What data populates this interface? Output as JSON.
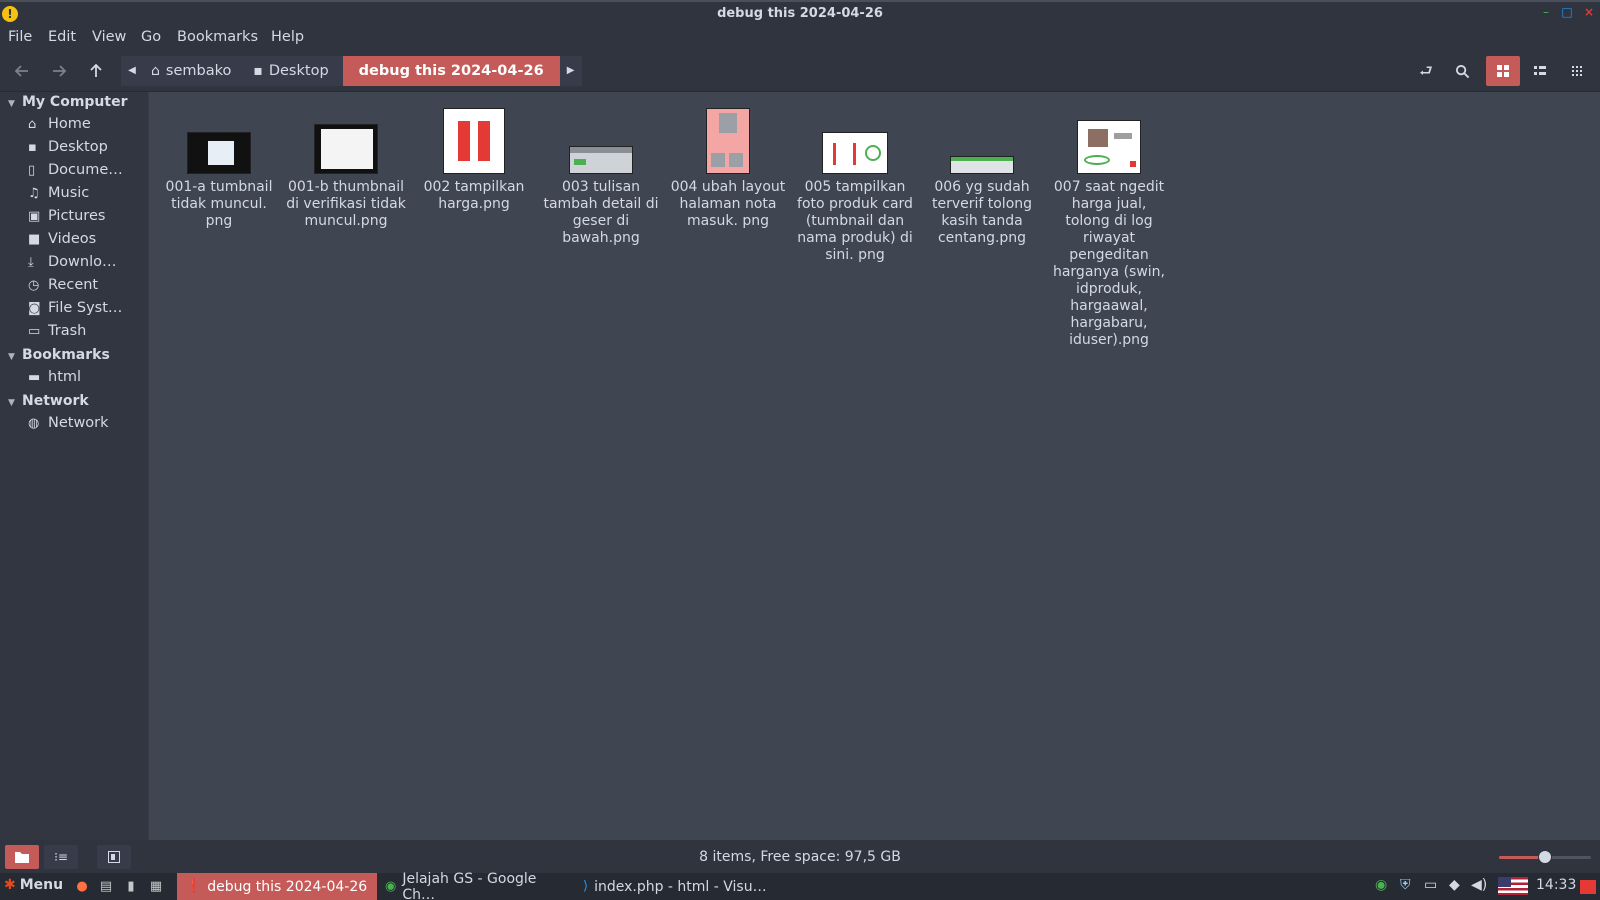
{
  "window": {
    "title": "debug this 2024-04-26",
    "warn_glyph": "!",
    "min_glyph": "–",
    "max_glyph": "□",
    "close_glyph": "×"
  },
  "menu": [
    "File",
    "Edit",
    "View",
    "Go",
    "Bookmarks",
    "Help"
  ],
  "toolbar": {
    "crumbs": [
      "sembako",
      "Desktop",
      "debug this 2024-04-26"
    ]
  },
  "sidebar": {
    "sections": [
      {
        "title": "My Computer",
        "items": [
          {
            "label": "Home",
            "icon": "home-icon"
          },
          {
            "label": "Desktop",
            "icon": "desktop-icon"
          },
          {
            "label": "Docume…",
            "icon": "document-icon"
          },
          {
            "label": "Music",
            "icon": "music-icon"
          },
          {
            "label": "Pictures",
            "icon": "pictures-icon"
          },
          {
            "label": "Videos",
            "icon": "videos-icon"
          },
          {
            "label": "Downlo…",
            "icon": "download-icon"
          },
          {
            "label": "Recent",
            "icon": "recent-icon"
          },
          {
            "label": "File Syst…",
            "icon": "filesystem-icon"
          },
          {
            "label": "Trash",
            "icon": "trash-icon"
          }
        ]
      },
      {
        "title": "Bookmarks",
        "items": [
          {
            "label": "html",
            "icon": "folder-icon"
          }
        ]
      },
      {
        "title": "Network",
        "items": [
          {
            "label": "Network",
            "icon": "network-icon"
          }
        ]
      }
    ]
  },
  "files": [
    {
      "name": "001-a tumbnail tidak muncul. png"
    },
    {
      "name": "001-b thumbnail di verifikasi tidak muncul.png"
    },
    {
      "name": "002 tampilkan harga.png"
    },
    {
      "name": "003 tulisan tambah detail di geser di bawah.png"
    },
    {
      "name": "004 ubah layout halaman nota masuk. png"
    },
    {
      "name": "005 tampilkan foto produk card (tumbnail dan nama produk) di sini. png"
    },
    {
      "name": "006 yg sudah terverif tolong kasih tanda centang.png"
    },
    {
      "name": "007 saat ngedit harga jual, tolong di log riwayat pengeditan harganya (swin, idproduk, hargaawal, hargabaru, iduser).png"
    }
  ],
  "status": {
    "text": "8 items, Free space: 97,5 GB",
    "zoom_level": 0.5
  },
  "taskbar": {
    "menu_label": "Menu",
    "tasks": [
      {
        "label": "debug this 2024-04-26",
        "icon": "file-manager-alert-icon"
      },
      {
        "label": "Jelajah GS - Google Ch…",
        "icon": "chrome-icon"
      },
      {
        "label": "index.php - html - Visu…",
        "icon": "vscode-icon"
      }
    ],
    "clock": "14:33"
  },
  "colors": {
    "accent": "#c45b59",
    "bg": "#383c4a",
    "content_bg": "#404552"
  }
}
